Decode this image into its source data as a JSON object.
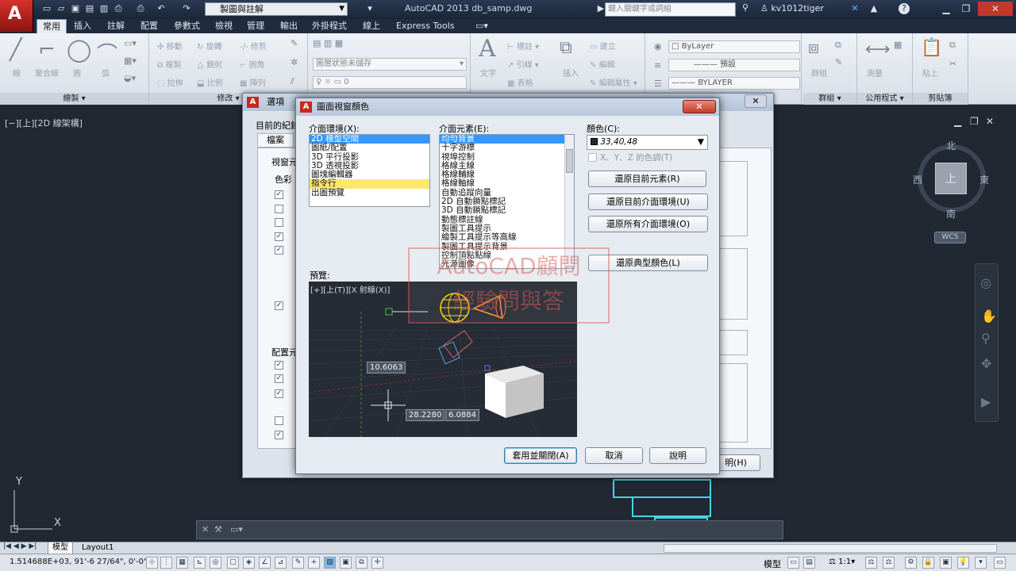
{
  "titlebar": {
    "workspace": "製圖與註解",
    "app_title": "AutoCAD 2013   db_samp.dwg",
    "search_placeholder": "鍵入關鍵字或詞組",
    "user": "kv1012tiger"
  },
  "tabs": [
    "常用",
    "插入",
    "註解",
    "配置",
    "參數式",
    "檢視",
    "管理",
    "輸出",
    "外掛程式",
    "線上",
    "Express Tools"
  ],
  "active_tab": "常用",
  "ribbon": {
    "draw_panel": "繪製",
    "modify_panel": "修改",
    "group_panel": "群組",
    "utilities_panel": "公用程式",
    "clipboard_panel": "剪貼簿",
    "draw_tools": [
      "線",
      "聚合線",
      "圓",
      "弧"
    ],
    "modify_tools": [
      "移動",
      "旋轉",
      "修剪",
      "複製",
      "鏡射",
      "圓角",
      "拉伸",
      "比例",
      "陣列"
    ],
    "layer_state": "圖層狀態未儲存",
    "layer_value": "0",
    "text_tool": "文字",
    "annot_tools": [
      "標註",
      "引線",
      "表格"
    ],
    "block_tools": [
      "插入",
      "建立",
      "編輯",
      "編輯屬性"
    ],
    "prop_color": "ByLayer",
    "prop_linetype": "預設",
    "prop_lineweight": "BYLAYER",
    "group_tool": "群組",
    "measure_tool": "測量",
    "paste_tool": "貼上"
  },
  "viewport": {
    "label": "[−][上][2D 線架構]",
    "compass": {
      "north": "北",
      "south": "南",
      "east": "東",
      "west": "西",
      "top": "上"
    },
    "wcs": "WCS",
    "ucs_x": "X",
    "ucs_y": "Y"
  },
  "options_dialog": {
    "title": "選項",
    "profile_label": "目前的紀錄",
    "first_tab": "檔案",
    "section1": "視窗元",
    "color_scheme": "色彩",
    "section2": "配置元",
    "help_button": "明(H)"
  },
  "color_dialog": {
    "title": "圖面視窗顏色",
    "context_label": "介面環境(X):",
    "contexts": [
      "2D 模型空間",
      "圖紙/配置",
      "3D 平行投影",
      "3D 透視投影",
      "圖塊編輯器",
      "指令行",
      "出圖預覽"
    ],
    "selected_context": 0,
    "element_label": "介面元素(E):",
    "elements": [
      "均勻背景",
      "十字游標",
      "視埠控制",
      "格線主線",
      "格線輔線",
      "格線軸線",
      "自動追蹤向量",
      "2D 自動鎖點標記",
      "3D 自動鎖點標記",
      "動態標註線",
      "製圖工具提示",
      "繪製工具提示等高線",
      "製圖工具提示背景",
      "控制頂點點線",
      "光源圖像"
    ],
    "selected_element": 0,
    "color_label": "顏色(C):",
    "color_value": "33,40,48",
    "color_swatch": "#212830",
    "tint_label": "X、Y、Z 的色調(T)",
    "btn_restore_element": "還原目前元素(R)",
    "btn_restore_context": "還原目前介面環境(U)",
    "btn_restore_all": "還原所有介面環境(O)",
    "btn_restore_classic": "還原典型顏色(L)",
    "preview_label": "預覽:",
    "preview_vp_label": "[+][上(T)][X 射線(X)]",
    "dim_values": [
      "10.6063",
      "28.2280",
      "6.0884"
    ],
    "btn_apply": "套用並關閉(A)",
    "btn_cancel": "取消",
    "btn_help": "說明"
  },
  "watermark": {
    "line1": "AutoCAD顧問",
    "line2": "經驗問與答"
  },
  "layout_tabs": [
    "模型",
    "Layout1"
  ],
  "status": {
    "coords": "1.514688E+03, 91'-6 27/64\", 0'-0\"",
    "space": "模型",
    "scale": "1:1"
  }
}
